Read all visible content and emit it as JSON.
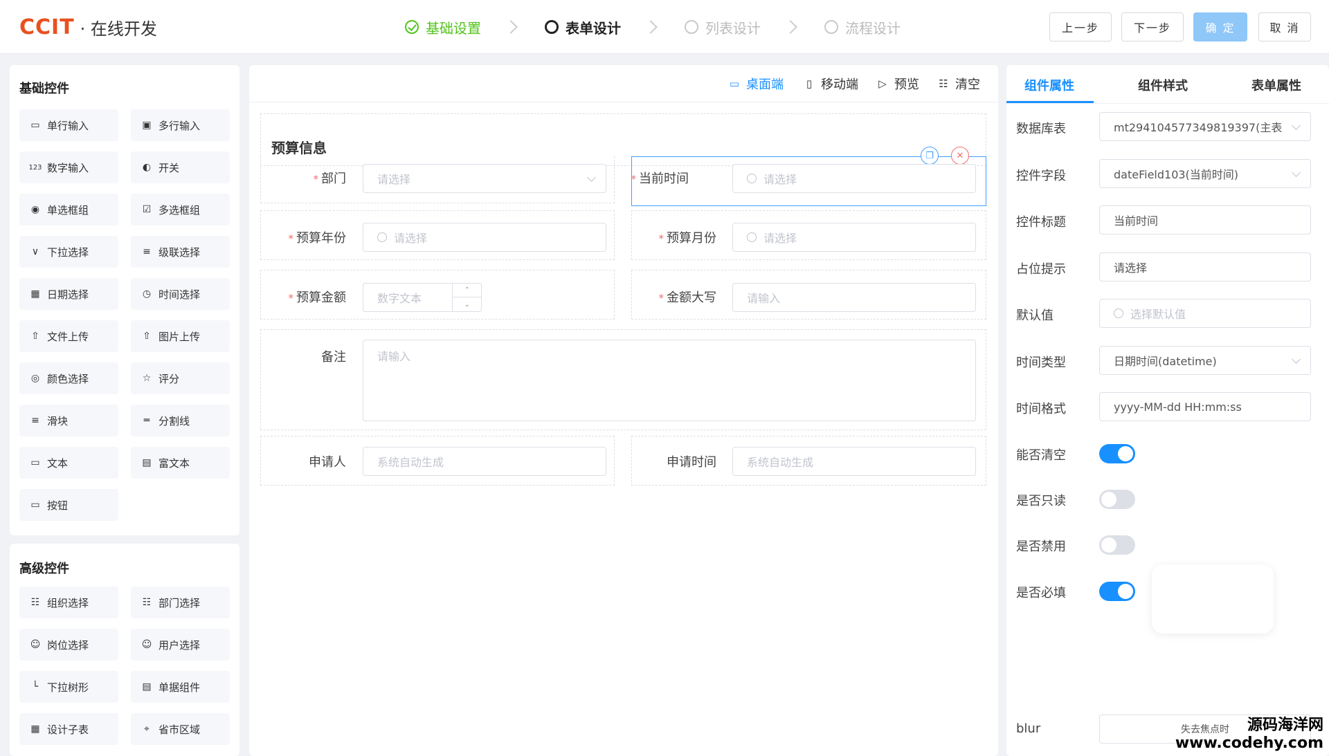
{
  "header": {
    "logo_brand": "CCIT",
    "logo_sub": "· 在线开发",
    "steps": [
      {
        "label": "基础设置",
        "state": "done"
      },
      {
        "label": "表单设计",
        "state": "active"
      },
      {
        "label": "列表设计",
        "state": "todo"
      },
      {
        "label": "流程设计",
        "state": "todo"
      }
    ],
    "buttons": {
      "prev": "上一步",
      "next": "下一步",
      "confirm": "确 定",
      "cancel": "取 消"
    }
  },
  "left": {
    "basic_title": "基础控件",
    "basic": [
      {
        "label": "单行输入",
        "icon": "input-icon"
      },
      {
        "label": "多行输入",
        "icon": "textarea-icon"
      },
      {
        "label": "数字输入",
        "icon": "number-icon"
      },
      {
        "label": "开关",
        "icon": "switch-icon"
      },
      {
        "label": "单选框组",
        "icon": "radio-icon"
      },
      {
        "label": "多选框组",
        "icon": "checkbox-icon"
      },
      {
        "label": "下拉选择",
        "icon": "select-icon"
      },
      {
        "label": "级联选择",
        "icon": "cascader-icon"
      },
      {
        "label": "日期选择",
        "icon": "calendar-icon"
      },
      {
        "label": "时间选择",
        "icon": "clock-icon"
      },
      {
        "label": "文件上传",
        "icon": "upload-icon"
      },
      {
        "label": "图片上传",
        "icon": "image-upload-icon"
      },
      {
        "label": "颜色选择",
        "icon": "palette-icon"
      },
      {
        "label": "评分",
        "icon": "star-icon"
      },
      {
        "label": "滑块",
        "icon": "slider-icon"
      },
      {
        "label": "分割线",
        "icon": "divider-icon"
      },
      {
        "label": "文本",
        "icon": "text-icon"
      },
      {
        "label": "富文本",
        "icon": "richtext-icon"
      },
      {
        "label": "按钮",
        "icon": "button-icon"
      }
    ],
    "advanced_title": "高级控件",
    "advanced": [
      {
        "label": "组织选择",
        "icon": "org-icon"
      },
      {
        "label": "部门选择",
        "icon": "department-icon"
      },
      {
        "label": "岗位选择",
        "icon": "post-icon"
      },
      {
        "label": "用户选择",
        "icon": "user-icon"
      },
      {
        "label": "下拉树形",
        "icon": "tree-icon"
      },
      {
        "label": "单据组件",
        "icon": "document-icon"
      },
      {
        "label": "设计子表",
        "icon": "table-icon"
      },
      {
        "label": "省市区域",
        "icon": "location-icon"
      }
    ]
  },
  "center": {
    "toolbar": {
      "desktop": "桌面端",
      "mobile": "移动端",
      "preview": "预览",
      "clear": "清空"
    },
    "section_title": "预算信息",
    "fields": {
      "dept_label": "部门",
      "dept_ph": "请选择",
      "curtime_label": "当前时间",
      "curtime_ph": "请选择",
      "year_label": "预算年份",
      "year_ph": "请选择",
      "month_label": "预算月份",
      "month_ph": "请选择",
      "amount_label": "预算金额",
      "amount_ph": "数字文本",
      "upper_label": "金额大写",
      "upper_ph": "请输入",
      "remark_label": "备注",
      "remark_ph": "请输入",
      "applicant_label": "申请人",
      "applicant_ph": "系统自动生成",
      "applytime_label": "申请时间",
      "applytime_ph": "系统自动生成"
    }
  },
  "right": {
    "tabs": [
      "组件属性",
      "组件样式",
      "表单属性"
    ],
    "props": {
      "db_label": "数据库表",
      "db_value": "mt294104577349819397(主表",
      "field_label": "控件字段",
      "field_value": "dateField103(当前时间)",
      "title_label": "控件标题",
      "title_value": "当前时间",
      "ph_label": "占位提示",
      "ph_value": "请选择",
      "default_label": "默认值",
      "default_ph": "选择默认值",
      "type_label": "时间类型",
      "type_value": "日期时间(datetime)",
      "format_label": "时间格式",
      "format_value": "yyyy-MM-dd HH:mm:ss",
      "clearable_label": "能否清空",
      "clearable": true,
      "readonly_label": "是否只读",
      "readonly": false,
      "disabled_label": "是否禁用",
      "disabled": false,
      "required_label": "是否必填",
      "required": true,
      "blur_label": "blur",
      "blur_value": "失去焦点时"
    }
  },
  "watermark": {
    "line1": "源码海洋网",
    "line2": "www.codehy.com"
  }
}
